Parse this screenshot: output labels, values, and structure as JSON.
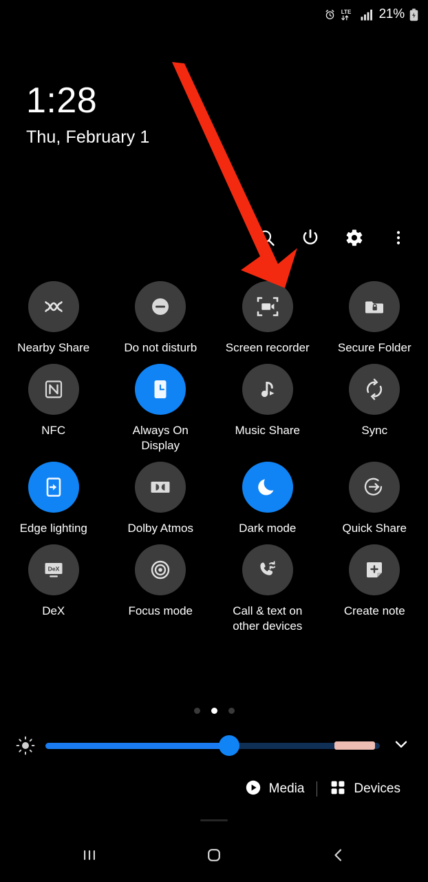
{
  "statusbar": {
    "alarm_icon": "alarm-icon",
    "network_label": "LTE",
    "network_icon": "lte-data-arrows-icon",
    "signal_icon": "signal-bars-icon",
    "battery_percent": "21%",
    "battery_icon": "battery-icon"
  },
  "clock": {
    "time": "1:28",
    "date": "Thu, February 1"
  },
  "header_actions": [
    {
      "name": "search-button",
      "icon": "search-icon"
    },
    {
      "name": "power-button",
      "icon": "power-icon"
    },
    {
      "name": "settings-button",
      "icon": "gear-icon"
    },
    {
      "name": "more-options-button",
      "icon": "three-dots-vertical-icon"
    }
  ],
  "tiles": [
    {
      "label": "Nearby Share",
      "icon": "nearby-share-icon",
      "state": "off"
    },
    {
      "label": "Do not disturb",
      "icon": "minus-circle-icon",
      "state": "off"
    },
    {
      "label": "Screen recorder",
      "icon": "screen-recorder-icon",
      "state": "off"
    },
    {
      "label": "Secure Folder",
      "icon": "lock-folder-icon",
      "state": "off"
    },
    {
      "label": "NFC",
      "icon": "nfc-icon",
      "state": "off"
    },
    {
      "label": "Always On Display",
      "icon": "always-on-display-icon",
      "state": "on"
    },
    {
      "label": "Music Share",
      "icon": "music-share-icon",
      "state": "off"
    },
    {
      "label": "Sync",
      "icon": "sync-icon",
      "state": "off"
    },
    {
      "label": "Edge lighting",
      "icon": "edge-lighting-icon",
      "state": "on"
    },
    {
      "label": "Dolby Atmos",
      "icon": "dolby-atmos-icon",
      "state": "off"
    },
    {
      "label": "Dark mode",
      "icon": "moon-icon",
      "state": "on"
    },
    {
      "label": "Quick Share",
      "icon": "quick-share-icon",
      "state": "off"
    },
    {
      "label": "DeX",
      "icon": "dex-monitor-icon",
      "state": "off",
      "icon_text": "DeX"
    },
    {
      "label": "Focus mode",
      "icon": "focus-target-icon",
      "state": "off"
    },
    {
      "label": "Call & text on other devices",
      "icon": "call-text-sync-icon",
      "state": "off"
    },
    {
      "label": "Create note",
      "icon": "create-note-icon",
      "state": "off"
    }
  ],
  "pager": {
    "page_count": 3,
    "active_page": 2
  },
  "brightness": {
    "icon": "brightness-sun-icon",
    "value_percent": 55,
    "auto_segment": true,
    "expand_icon": "chevron-down-icon"
  },
  "footer": {
    "media_label": "Media",
    "media_icon": "play-circle-icon",
    "devices_label": "Devices",
    "devices_icon": "grid-squares-icon"
  },
  "navbar": [
    {
      "name": "recents-button",
      "icon": "recents-bars-icon"
    },
    {
      "name": "home-button",
      "icon": "home-square-icon"
    },
    {
      "name": "back-button",
      "icon": "back-chevron-icon"
    }
  ],
  "annotation": {
    "type": "arrow",
    "color": "#F42A10",
    "points_to": "Screen recorder"
  },
  "colors": {
    "background": "#000000",
    "tile_off": "#3d3d3d",
    "tile_on": "#1184f5",
    "accent_blue": "#1a7bf0",
    "slider_auto": "#edbdb4",
    "text": "#ffffff"
  }
}
